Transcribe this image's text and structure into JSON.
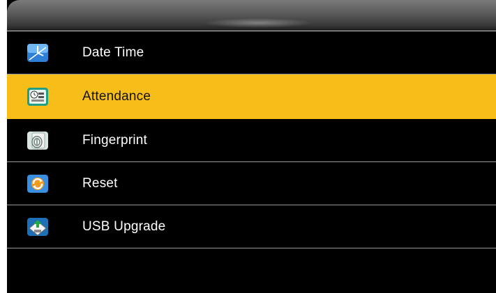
{
  "menu": {
    "items": [
      {
        "label": "Date Time",
        "icon": "clock-icon",
        "selected": false
      },
      {
        "label": "Attendance",
        "icon": "attendance-icon",
        "selected": true
      },
      {
        "label": "Fingerprint",
        "icon": "fingerprint-icon",
        "selected": false
      },
      {
        "label": "Reset",
        "icon": "reset-icon",
        "selected": false
      },
      {
        "label": "USB Upgrade",
        "icon": "usb-icon",
        "selected": false
      }
    ]
  },
  "colors": {
    "background": "#000000",
    "highlight": "#f7be1a",
    "text": "#ffffff",
    "selected_text": "#111111",
    "divider": "#9a9a9a"
  }
}
